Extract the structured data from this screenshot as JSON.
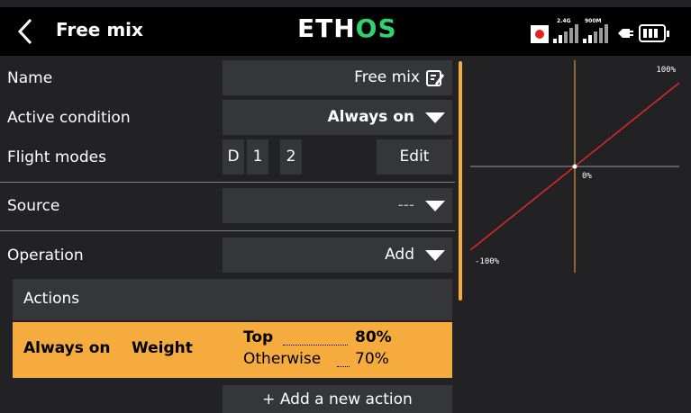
{
  "header": {
    "title": "Free mix",
    "logo_part1": "ETH",
    "logo_part2": "OS",
    "status": {
      "rx1_label": "2.4G",
      "rx2_label": "900M",
      "signal1_level": 0.4,
      "signal2_level": 0.4,
      "battery_level": 0.75
    }
  },
  "form": {
    "name": {
      "label": "Name",
      "value": "Free mix"
    },
    "active_condition": {
      "label": "Active condition",
      "value": "Always on"
    },
    "flight_modes": {
      "label": "Flight modes",
      "modes": [
        "D",
        "1",
        "2"
      ],
      "edit_label": "Edit"
    },
    "source": {
      "label": "Source",
      "value": "---"
    },
    "operation": {
      "label": "Operation",
      "value": "Add"
    }
  },
  "actions": {
    "header": "Actions",
    "row": {
      "condition": "Always on",
      "target": "Weight",
      "top_label": "Top",
      "top_value": "80%",
      "otherwise_label": "Otherwise",
      "otherwise_value": "70%"
    },
    "add_label": "+ Add a new action"
  },
  "graph": {
    "top_label": "100%",
    "center_label": "0%",
    "bottom_label": "-100%",
    "colors": {
      "curve": "#e0282c",
      "axis_v": "#f5ab3d",
      "axis_h": "#9a9a9a"
    }
  },
  "colors": {
    "accent": "#f5ab3d",
    "field": "#35363a",
    "logo_green": "#2fd26e"
  }
}
